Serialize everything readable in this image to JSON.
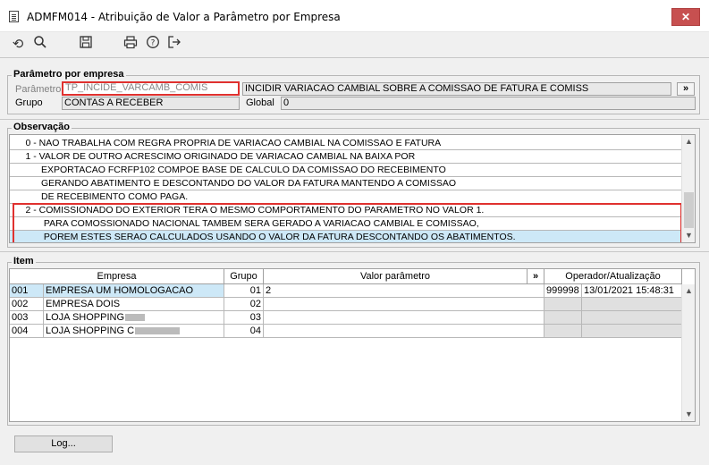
{
  "window": {
    "title": "ADMFM014 - Atribuição de Valor a Parâmetro por Empresa",
    "close_label": "✕"
  },
  "toolbar": {
    "icons": [
      "undo-icon",
      "search-icon",
      "save-icon",
      "print-icon",
      "help-icon",
      "exit-icon"
    ]
  },
  "parametro_group": {
    "title": "Parâmetro por empresa",
    "parametro_label": "Parâmetro",
    "parametro_code": "TP_INCIDE_VARCAMB_COMIS",
    "parametro_desc": "INCIDIR VARIACAO CAMBIAL SOBRE A COMISSAO DE FATURA E COMISS",
    "expand_label": "»",
    "grupo_label": "Grupo",
    "grupo_value": "CONTAS A RECEBER",
    "global_label": "Global",
    "global_value": "0"
  },
  "observacao": {
    "title": "Observação",
    "lines": [
      "      0 - NAO TRABALHA COM REGRA PROPRIA DE VARIACAO CAMBIAL NA COMISSAO E FATURA",
      "      1 - VALOR DE OUTRO ACRESCIMO ORIGINADO DE VARIACAO CAMBIAL NA BAIXA POR",
      "            EXPORTACAO FCRFP102 COMPOE BASE DE CALCULO DA COMISSAO DO RECEBIMENTO",
      "            GERANDO ABATIMENTO E DESCONTANDO DO VALOR DA FATURA MANTENDO A COMISSAO",
      "            DE RECEBIMENTO COMO PAGA.",
      "      2 - COMISSIONADO DO EXTERIOR TERA O MESMO COMPORTAMENTO DO PARAMETRO NO VALOR 1.",
      "             PARA COMOSSIONADO NACIONAL TAMBEM SERA GERADO A VARIACAO CAMBIAL E COMISSAO,",
      "             POREM ESTES SERAO CALCULADOS USANDO O VALOR DA FATURA DESCONTANDO OS ABATIMENTOS."
    ]
  },
  "item": {
    "title": "Item",
    "headers": {
      "empresa": "Empresa",
      "grupo": "Grupo",
      "valor": "Valor parâmetro",
      "expand": "»",
      "operador": "Operador/Atualização"
    },
    "rows": [
      {
        "code": "001",
        "empresa": "EMPRESA UM HOMOLOGACAO",
        "grupo": "01",
        "valor": "2",
        "operador": "999998",
        "atualizacao": "13/01/2021 15:48:31"
      },
      {
        "code": "002",
        "empresa": "EMPRESA DOIS",
        "grupo": "02",
        "valor": "",
        "operador": "",
        "atualizacao": ""
      },
      {
        "code": "003",
        "empresa": "LOJA SHOPPING",
        "grupo": "03",
        "valor": "",
        "operador": "",
        "atualizacao": ""
      },
      {
        "code": "004",
        "empresa": "LOJA SHOPPING C",
        "grupo": "04",
        "valor": "",
        "operador": "",
        "atualizacao": ""
      }
    ]
  },
  "footer": {
    "log_label": "Log..."
  }
}
